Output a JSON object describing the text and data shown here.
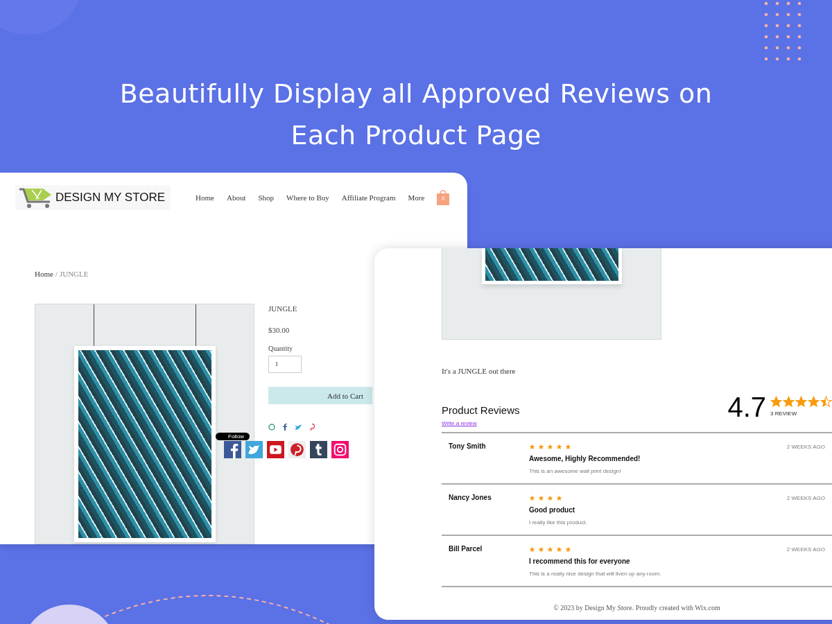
{
  "headline": "Beautifully Display all Approved Reviews on Each Product Page",
  "store_page": {
    "logo": "DESIGN MY STORE",
    "nav": [
      "Home",
      "About",
      "Shop",
      "Where to Buy",
      "Affiliate Program",
      "More"
    ],
    "cart_count": "0",
    "breadcrumb": {
      "home": "Home",
      "separator": "/",
      "current": "JUNGLE"
    },
    "product": {
      "name": "JUNGLE",
      "price": "$30.00",
      "quantity_label": "Quantity",
      "quantity": "1",
      "add_to_cart": "Add to Cart"
    },
    "follow_label": "Follow"
  },
  "reviews_page": {
    "description": "It's a JUNGLE out there",
    "title": "Product Reviews",
    "write_review": "Write a review",
    "rating": "4.7",
    "stars": 4.5,
    "review_count": "3 REVIEW",
    "reviews": [
      {
        "name": "Tony Smith",
        "stars": 5,
        "time": "2 WEEKS AGO",
        "title": "Awesome, Highly Recommended!",
        "body": "This is an awesome wall print design!"
      },
      {
        "name": "Nancy Jones",
        "stars": 4,
        "time": "2 WEEKS AGO",
        "title": "Good product",
        "body": "I really like this product."
      },
      {
        "name": "Bill Parcel",
        "stars": 5,
        "time": "2 WEEKS AGO",
        "title": "I recommend this for everyone",
        "body": "This is a really nice design that will liven up any room."
      }
    ],
    "footer": "© 2023 by Design My Store. Proudly created with Wix.com"
  }
}
